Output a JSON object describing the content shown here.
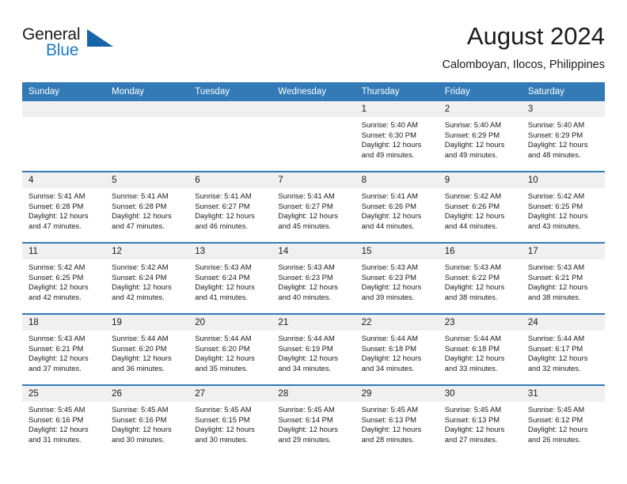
{
  "brand": {
    "name_part1": "General",
    "name_part2": "Blue",
    "flag_icon": "triangle-flag-icon"
  },
  "header": {
    "title": "August 2024",
    "subtitle": "Calomboyan, Ilocos, Philippines"
  },
  "colors": {
    "header_blue": "#337ab7",
    "brand_blue": "#1f7ac4",
    "day_number_band": "#f0f0f0",
    "text": "#1a1a1a"
  },
  "weekdays": [
    "Sunday",
    "Monday",
    "Tuesday",
    "Wednesday",
    "Thursday",
    "Friday",
    "Saturday"
  ],
  "weeks": [
    [
      {
        "day": "",
        "sunrise": "",
        "sunset": "",
        "daylight1": "",
        "daylight2": "",
        "empty": true
      },
      {
        "day": "",
        "sunrise": "",
        "sunset": "",
        "daylight1": "",
        "daylight2": "",
        "empty": true
      },
      {
        "day": "",
        "sunrise": "",
        "sunset": "",
        "daylight1": "",
        "daylight2": "",
        "empty": true
      },
      {
        "day": "",
        "sunrise": "",
        "sunset": "",
        "daylight1": "",
        "daylight2": "",
        "empty": true
      },
      {
        "day": "1",
        "sunrise": "Sunrise: 5:40 AM",
        "sunset": "Sunset: 6:30 PM",
        "daylight1": "Daylight: 12 hours",
        "daylight2": "and 49 minutes."
      },
      {
        "day": "2",
        "sunrise": "Sunrise: 5:40 AM",
        "sunset": "Sunset: 6:29 PM",
        "daylight1": "Daylight: 12 hours",
        "daylight2": "and 49 minutes."
      },
      {
        "day": "3",
        "sunrise": "Sunrise: 5:40 AM",
        "sunset": "Sunset: 6:29 PM",
        "daylight1": "Daylight: 12 hours",
        "daylight2": "and 48 minutes."
      }
    ],
    [
      {
        "day": "4",
        "sunrise": "Sunrise: 5:41 AM",
        "sunset": "Sunset: 6:28 PM",
        "daylight1": "Daylight: 12 hours",
        "daylight2": "and 47 minutes."
      },
      {
        "day": "5",
        "sunrise": "Sunrise: 5:41 AM",
        "sunset": "Sunset: 6:28 PM",
        "daylight1": "Daylight: 12 hours",
        "daylight2": "and 47 minutes."
      },
      {
        "day": "6",
        "sunrise": "Sunrise: 5:41 AM",
        "sunset": "Sunset: 6:27 PM",
        "daylight1": "Daylight: 12 hours",
        "daylight2": "and 46 minutes."
      },
      {
        "day": "7",
        "sunrise": "Sunrise: 5:41 AM",
        "sunset": "Sunset: 6:27 PM",
        "daylight1": "Daylight: 12 hours",
        "daylight2": "and 45 minutes."
      },
      {
        "day": "8",
        "sunrise": "Sunrise: 5:41 AM",
        "sunset": "Sunset: 6:26 PM",
        "daylight1": "Daylight: 12 hours",
        "daylight2": "and 44 minutes."
      },
      {
        "day": "9",
        "sunrise": "Sunrise: 5:42 AM",
        "sunset": "Sunset: 6:26 PM",
        "daylight1": "Daylight: 12 hours",
        "daylight2": "and 44 minutes."
      },
      {
        "day": "10",
        "sunrise": "Sunrise: 5:42 AM",
        "sunset": "Sunset: 6:25 PM",
        "daylight1": "Daylight: 12 hours",
        "daylight2": "and 43 minutes."
      }
    ],
    [
      {
        "day": "11",
        "sunrise": "Sunrise: 5:42 AM",
        "sunset": "Sunset: 6:25 PM",
        "daylight1": "Daylight: 12 hours",
        "daylight2": "and 42 minutes."
      },
      {
        "day": "12",
        "sunrise": "Sunrise: 5:42 AM",
        "sunset": "Sunset: 6:24 PM",
        "daylight1": "Daylight: 12 hours",
        "daylight2": "and 42 minutes."
      },
      {
        "day": "13",
        "sunrise": "Sunrise: 5:43 AM",
        "sunset": "Sunset: 6:24 PM",
        "daylight1": "Daylight: 12 hours",
        "daylight2": "and 41 minutes."
      },
      {
        "day": "14",
        "sunrise": "Sunrise: 5:43 AM",
        "sunset": "Sunset: 6:23 PM",
        "daylight1": "Daylight: 12 hours",
        "daylight2": "and 40 minutes."
      },
      {
        "day": "15",
        "sunrise": "Sunrise: 5:43 AM",
        "sunset": "Sunset: 6:23 PM",
        "daylight1": "Daylight: 12 hours",
        "daylight2": "and 39 minutes."
      },
      {
        "day": "16",
        "sunrise": "Sunrise: 5:43 AM",
        "sunset": "Sunset: 6:22 PM",
        "daylight1": "Daylight: 12 hours",
        "daylight2": "and 38 minutes."
      },
      {
        "day": "17",
        "sunrise": "Sunrise: 5:43 AM",
        "sunset": "Sunset: 6:21 PM",
        "daylight1": "Daylight: 12 hours",
        "daylight2": "and 38 minutes."
      }
    ],
    [
      {
        "day": "18",
        "sunrise": "Sunrise: 5:43 AM",
        "sunset": "Sunset: 6:21 PM",
        "daylight1": "Daylight: 12 hours",
        "daylight2": "and 37 minutes."
      },
      {
        "day": "19",
        "sunrise": "Sunrise: 5:44 AM",
        "sunset": "Sunset: 6:20 PM",
        "daylight1": "Daylight: 12 hours",
        "daylight2": "and 36 minutes."
      },
      {
        "day": "20",
        "sunrise": "Sunrise: 5:44 AM",
        "sunset": "Sunset: 6:20 PM",
        "daylight1": "Daylight: 12 hours",
        "daylight2": "and 35 minutes."
      },
      {
        "day": "21",
        "sunrise": "Sunrise: 5:44 AM",
        "sunset": "Sunset: 6:19 PM",
        "daylight1": "Daylight: 12 hours",
        "daylight2": "and 34 minutes."
      },
      {
        "day": "22",
        "sunrise": "Sunrise: 5:44 AM",
        "sunset": "Sunset: 6:18 PM",
        "daylight1": "Daylight: 12 hours",
        "daylight2": "and 34 minutes."
      },
      {
        "day": "23",
        "sunrise": "Sunrise: 5:44 AM",
        "sunset": "Sunset: 6:18 PM",
        "daylight1": "Daylight: 12 hours",
        "daylight2": "and 33 minutes."
      },
      {
        "day": "24",
        "sunrise": "Sunrise: 5:44 AM",
        "sunset": "Sunset: 6:17 PM",
        "daylight1": "Daylight: 12 hours",
        "daylight2": "and 32 minutes."
      }
    ],
    [
      {
        "day": "25",
        "sunrise": "Sunrise: 5:45 AM",
        "sunset": "Sunset: 6:16 PM",
        "daylight1": "Daylight: 12 hours",
        "daylight2": "and 31 minutes."
      },
      {
        "day": "26",
        "sunrise": "Sunrise: 5:45 AM",
        "sunset": "Sunset: 6:16 PM",
        "daylight1": "Daylight: 12 hours",
        "daylight2": "and 30 minutes."
      },
      {
        "day": "27",
        "sunrise": "Sunrise: 5:45 AM",
        "sunset": "Sunset: 6:15 PM",
        "daylight1": "Daylight: 12 hours",
        "daylight2": "and 30 minutes."
      },
      {
        "day": "28",
        "sunrise": "Sunrise: 5:45 AM",
        "sunset": "Sunset: 6:14 PM",
        "daylight1": "Daylight: 12 hours",
        "daylight2": "and 29 minutes."
      },
      {
        "day": "29",
        "sunrise": "Sunrise: 5:45 AM",
        "sunset": "Sunset: 6:13 PM",
        "daylight1": "Daylight: 12 hours",
        "daylight2": "and 28 minutes."
      },
      {
        "day": "30",
        "sunrise": "Sunrise: 5:45 AM",
        "sunset": "Sunset: 6:13 PM",
        "daylight1": "Daylight: 12 hours",
        "daylight2": "and 27 minutes."
      },
      {
        "day": "31",
        "sunrise": "Sunrise: 5:45 AM",
        "sunset": "Sunset: 6:12 PM",
        "daylight1": "Daylight: 12 hours",
        "daylight2": "and 26 minutes."
      }
    ]
  ]
}
